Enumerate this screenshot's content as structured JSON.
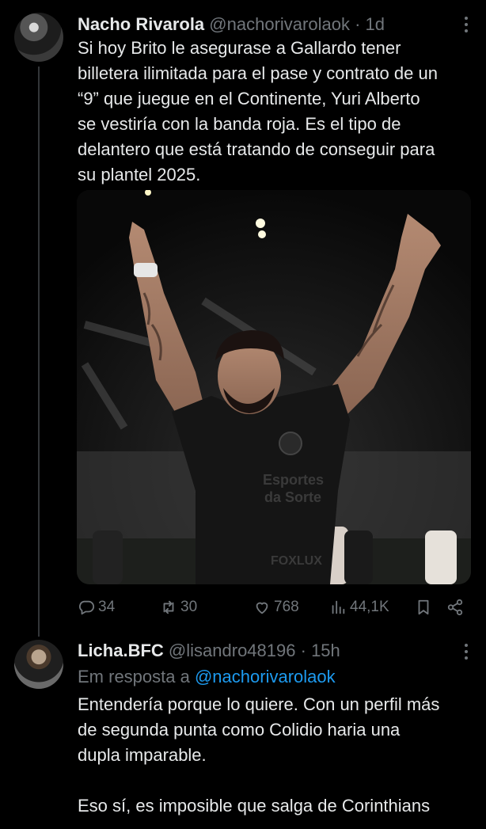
{
  "tweet1": {
    "name": "Nacho Rivarola",
    "handle": "@nachorivarolaok",
    "separator": "·",
    "time": "1d",
    "text_lines": [
      "Si hoy Brito le asegurase a Gallardo tener",
      "billetera ilimitada para el pase y contrato de un",
      "“9” que juegue en el Continente, Yuri Alberto",
      "se vestiría con la banda roja. Es el tipo de",
      "delantero que está tratando de conseguir para",
      "su plantel 2025."
    ],
    "media": {
      "shirt_sponsor_line1": "Esportes",
      "shirt_sponsor_line2": "da Sorte",
      "shirt_bottom": "FOXLUX"
    },
    "stats": {
      "replies": "34",
      "reposts": "30",
      "likes": "768",
      "views": "44,1K"
    }
  },
  "tweet2": {
    "name": "Licha.BFC",
    "handle": "@lisandro48196",
    "separator": "·",
    "time": "15h",
    "reply_prefix": "Em resposta a",
    "reply_to": "@nachorivarolaok",
    "text_lines": [
      "Entendería porque lo quiere. Con un perfil más",
      "de segunda punta como Colidio haria una",
      "dupla imparable.",
      "",
      "Eso sí, es imposible que salga de Corinthians"
    ]
  },
  "colors": {
    "background": "#000000",
    "text": "#e7e9ea",
    "muted": "#71767b",
    "link": "#1d9bf0"
  }
}
